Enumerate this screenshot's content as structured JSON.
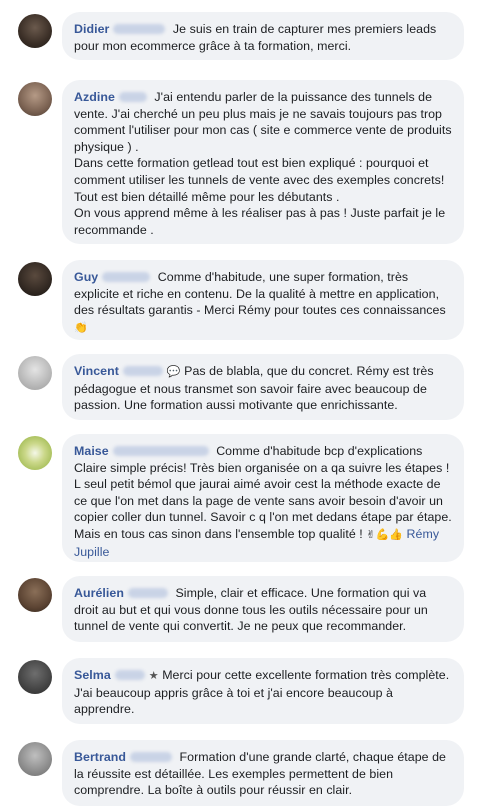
{
  "comments": [
    {
      "first_name": "Didier",
      "text": "Je suis en train de capturer mes premiers leads pour mon ecommerce grâce à ta formation, merci."
    },
    {
      "first_name": "Azdine",
      "text": "J'ai entendu parler de la puissance des tunnels de vente. J'ai cherché un peu plus mais je ne savais toujours pas trop comment l'utiliser pour mon cas ( site e commerce vente de produits physique ) .\nDans cette formation getlead tout est bien expliqué : pourquoi et comment utiliser les tunnels de vente avec des exemples concrets! Tout est bien détaillé même pour les débutants .\nOn vous apprend même à les réaliser pas à pas ! Juste parfait je le recommande ."
    },
    {
      "first_name": "Guy",
      "text": "Comme d'habitude, une super formation, très explicite et riche en contenu. De la qualité à mettre en application, des résultats garantis - Merci Rémy pour toutes ces connaissances",
      "emoji": "👏"
    },
    {
      "first_name": "Vincent",
      "prefix_emoji": "💬",
      "text": "Pas de blabla, que du concret. Rémy est très pédagogue et nous transmet son savoir faire avec beaucoup de passion. Une formation aussi motivante que enrichissante."
    },
    {
      "first_name": "Maise",
      "text": "Comme d'habitude bcp d'explications Claire simple précis! Très bien organisée on a qa suivre les étapes ! L seul petit bémol que jaurai aimé avoir cest la méthode exacte de ce que l'on met dans la page de vente sans avoir besoin d'avoir un copier coller dun tunnel. Savoir c q l'on met dedans étape par étape. Mais en tous cas sinon dans l'ensemble top qualité !",
      "emoji": "✌💪👍",
      "mention": "Rémy Jupille"
    },
    {
      "first_name": "Aurélien",
      "text": "Simple, clair et efficace. Une formation qui va droit au but et qui vous donne tous les outils nécessaire pour un tunnel de vente qui convertit. Je ne peux que recommander."
    },
    {
      "first_name": "Selma",
      "prefix_emoji": "★",
      "text": "Merci pour cette excellente formation très complète. J'ai beaucoup appris grâce à toi et j'ai encore beaucoup à apprendre."
    },
    {
      "first_name": "Bertrand",
      "text": "Formation d'une grande clarté, chaque étape de la réussite est détaillée. Les exemples permettent de bien comprendre. La boîte à outils pour réussir en clair."
    }
  ],
  "colors": {
    "name": "#385898",
    "bubble": "#f0f2f5",
    "text": "#1c1e21"
  }
}
